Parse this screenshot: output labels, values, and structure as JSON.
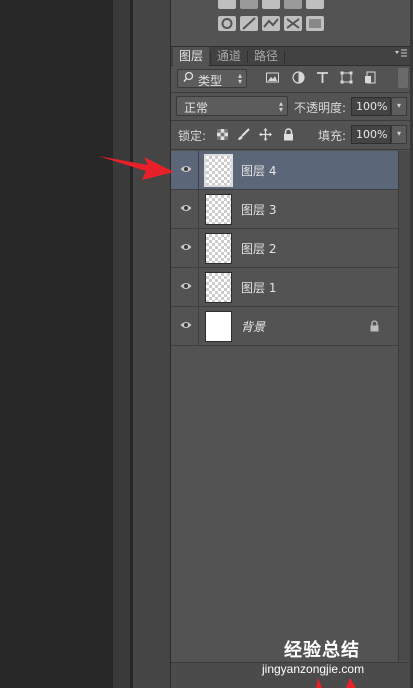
{
  "tabs": [
    {
      "label": "图层",
      "active": true
    },
    {
      "label": "通道",
      "active": false
    },
    {
      "label": "路径",
      "active": false
    }
  ],
  "panel_menu_icon": "panel-menu-icon",
  "filter": {
    "kind_label": "类型",
    "icons": [
      "pixel-filter-icon",
      "adjustment-filter-icon",
      "type-filter-icon",
      "shape-filter-icon",
      "smart-object-filter-icon"
    ]
  },
  "blend": {
    "mode": "正常",
    "opacity_label": "不透明度:",
    "opacity_value": "100%"
  },
  "lock": {
    "label": "锁定:",
    "icons": [
      "lock-transparent-icon",
      "lock-image-icon",
      "lock-position-icon",
      "lock-all-icon"
    ],
    "fill_label": "填充:",
    "fill_value": "100%"
  },
  "layers": [
    {
      "name": "图层 4",
      "selected": true,
      "thumbnail": "transparent",
      "locked": false
    },
    {
      "name": "图层 3",
      "selected": false,
      "thumbnail": "transparent",
      "locked": false
    },
    {
      "name": "图层 2",
      "selected": false,
      "thumbnail": "transparent",
      "locked": false
    },
    {
      "name": "图层 1",
      "selected": false,
      "thumbnail": "transparent",
      "locked": false
    },
    {
      "name": "背景",
      "selected": false,
      "thumbnail": "white",
      "locked": true
    }
  ],
  "colors": {
    "panel_bg": "#535353",
    "selected_row": "#5b6678",
    "annotation_red": "#e8202a"
  },
  "watermark": {
    "title": "经验总结",
    "url": "jingyanzongjie.com"
  }
}
